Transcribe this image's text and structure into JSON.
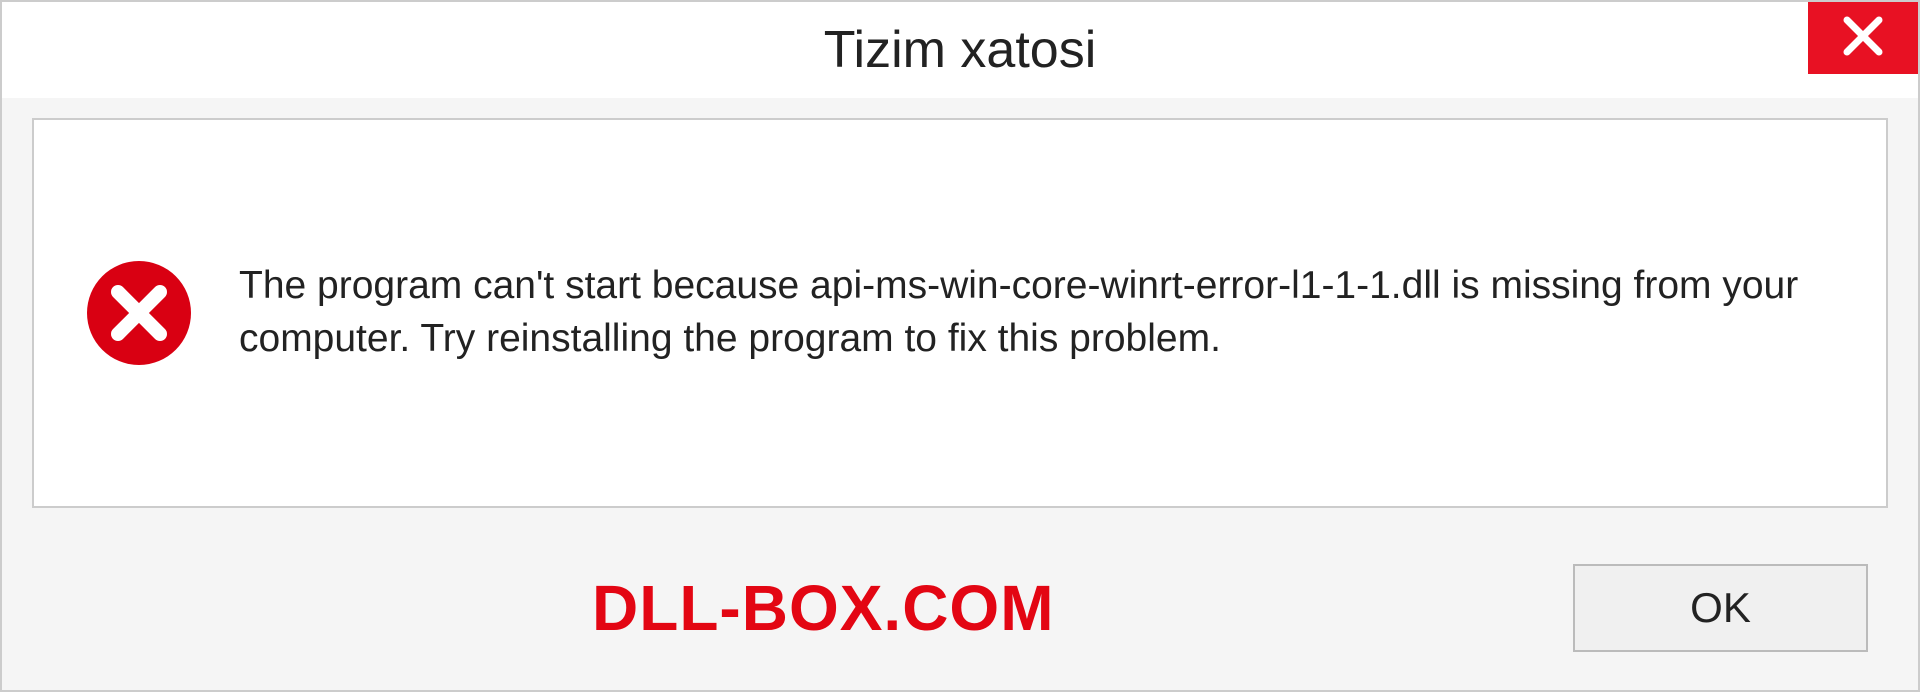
{
  "titlebar": {
    "title": "Tizim xatosi"
  },
  "content": {
    "message": "The program can't start because api-ms-win-core-winrt-error-l1-1-1.dll is missing from your computer. Try reinstalling the program to fix this problem."
  },
  "footer": {
    "watermark": "DLL-BOX.COM",
    "ok_label": "OK"
  }
}
